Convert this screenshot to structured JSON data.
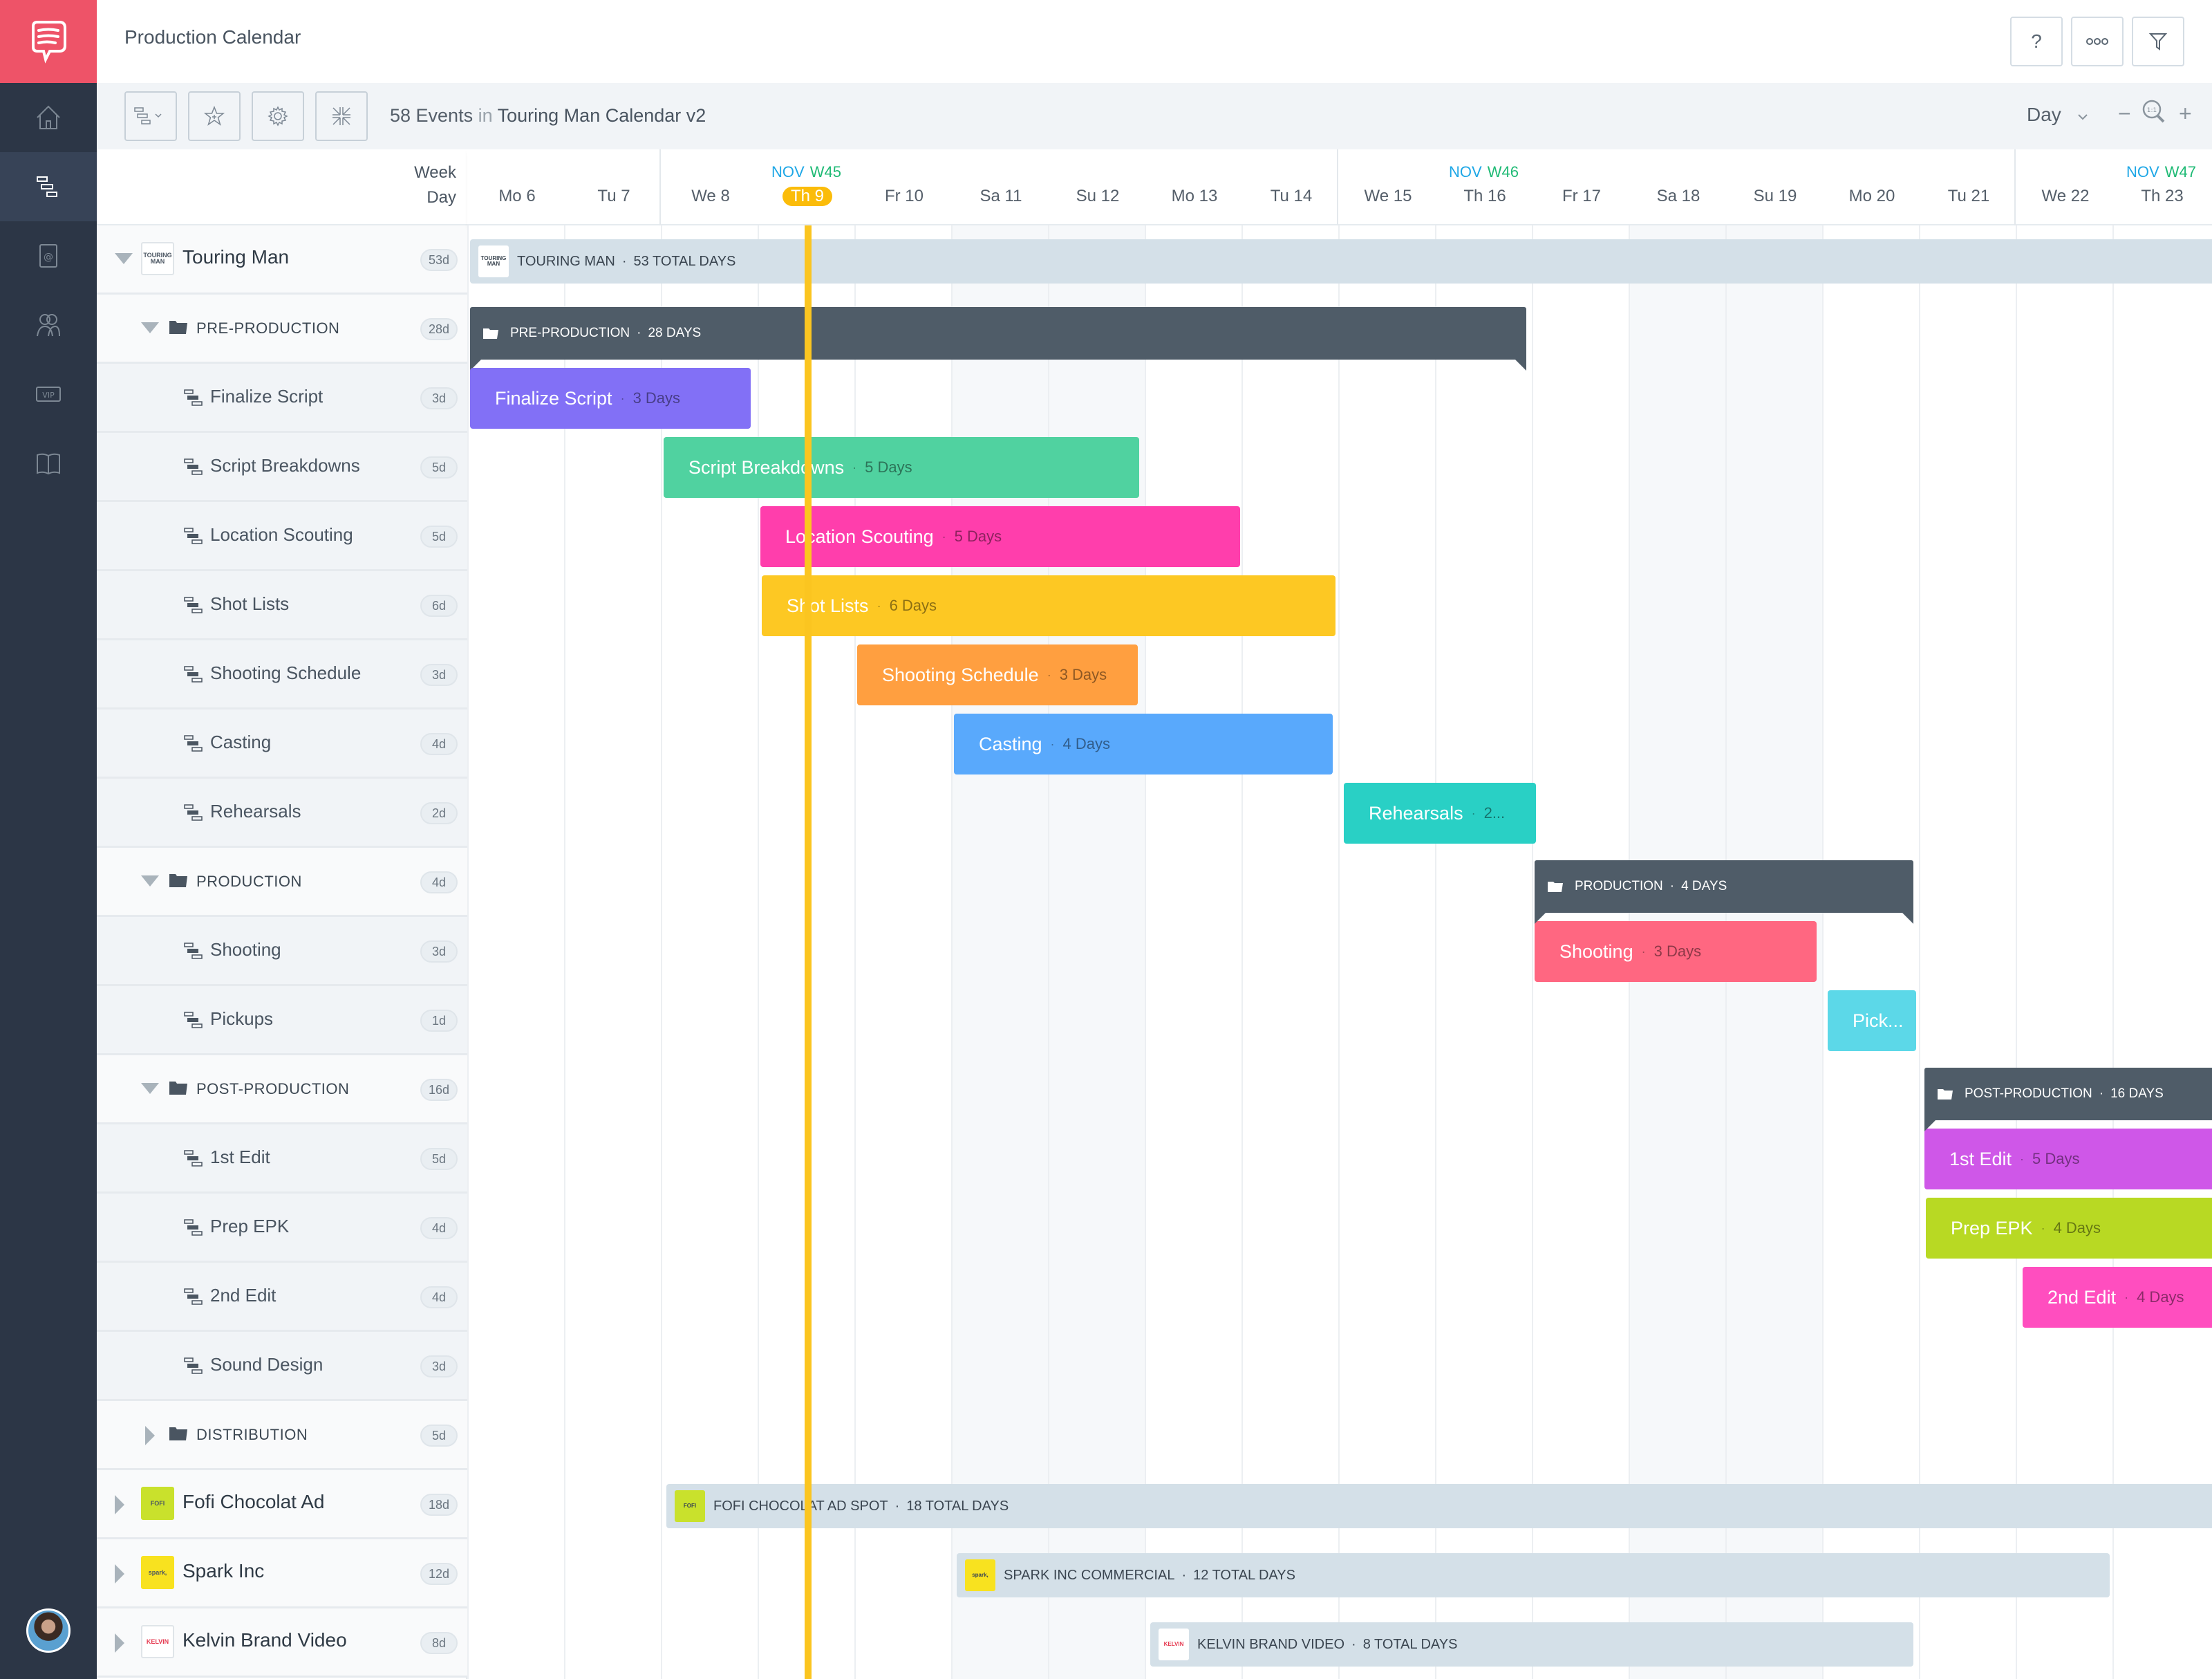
{
  "app": {
    "title": "Production Calendar",
    "events_count": "58 Events",
    "events_in": "in",
    "calendar_name": "Touring Man Calendar v2"
  },
  "topbar": {
    "help_label": "?",
    "more_label": "ooo",
    "filter_label": "filter"
  },
  "toolbar": {
    "view_select": "Day",
    "zoom_out": "−",
    "zoom_reset": "1:1",
    "zoom_in": "+"
  },
  "sidebar": {
    "items": [
      {
        "name": "home"
      },
      {
        "name": "gantt-timeline",
        "active": true
      },
      {
        "name": "contacts"
      },
      {
        "name": "team"
      },
      {
        "name": "vip"
      },
      {
        "name": "script-library"
      }
    ]
  },
  "timeline": {
    "header_week": "Week",
    "header_day": "Day",
    "weeks": [
      {
        "month": "NOV",
        "week": "W45"
      },
      {
        "month": "NOV",
        "week": "W46"
      },
      {
        "month": "NOV",
        "week": "W47"
      }
    ],
    "days": [
      {
        "label": "Mo 6"
      },
      {
        "label": "Tu 7"
      },
      {
        "label": "We 8"
      },
      {
        "label": "Th 9",
        "today": true
      },
      {
        "label": "Fr 10"
      },
      {
        "label": "Sa 11"
      },
      {
        "label": "Su 12"
      },
      {
        "label": "Mo 13"
      },
      {
        "label": "Tu 14"
      },
      {
        "label": "We 15"
      },
      {
        "label": "Th 16"
      },
      {
        "label": "Fr 17"
      },
      {
        "label": "Sa 18"
      },
      {
        "label": "Su 19"
      },
      {
        "label": "Mo 20"
      },
      {
        "label": "Tu 21"
      },
      {
        "label": "We 22"
      },
      {
        "label": "Th 23"
      }
    ]
  },
  "rows": [
    {
      "type": "project",
      "label": "Touring Man",
      "badge": "53d",
      "logo": "TOURING MAN",
      "expanded": true
    },
    {
      "type": "group",
      "label": "PRE-PRODUCTION",
      "badge": "28d",
      "expanded": true
    },
    {
      "type": "task",
      "label": "Finalize Script",
      "badge": "3d"
    },
    {
      "type": "task",
      "label": "Script Breakdowns",
      "badge": "5d"
    },
    {
      "type": "task",
      "label": "Location Scouting",
      "badge": "5d"
    },
    {
      "type": "task",
      "label": "Shot Lists",
      "badge": "6d"
    },
    {
      "type": "task",
      "label": "Shooting Schedule",
      "badge": "3d"
    },
    {
      "type": "task",
      "label": "Casting",
      "badge": "4d"
    },
    {
      "type": "task",
      "label": "Rehearsals",
      "badge": "2d"
    },
    {
      "type": "group",
      "label": "PRODUCTION",
      "badge": "4d",
      "expanded": true
    },
    {
      "type": "task",
      "label": "Shooting",
      "badge": "3d"
    },
    {
      "type": "task",
      "label": "Pickups",
      "badge": "1d"
    },
    {
      "type": "group",
      "label": "POST-PRODUCTION",
      "badge": "16d",
      "expanded": true
    },
    {
      "type": "task",
      "label": "1st Edit",
      "badge": "5d"
    },
    {
      "type": "task",
      "label": "Prep EPK",
      "badge": "4d"
    },
    {
      "type": "task",
      "label": "2nd Edit",
      "badge": "4d"
    },
    {
      "type": "task",
      "label": "Sound Design",
      "badge": "3d"
    },
    {
      "type": "group",
      "label": "DISTRIBUTION",
      "badge": "5d",
      "expanded": false
    },
    {
      "type": "project",
      "label": "Fofi Chocolat Ad",
      "badge": "18d",
      "logo": "FOFI",
      "expanded": false
    },
    {
      "type": "project",
      "label": "Spark Inc",
      "badge": "12d",
      "logo": "spark,",
      "expanded": false
    },
    {
      "type": "project",
      "label": "Kelvin Brand Video",
      "badge": "8d",
      "logo": "KELVIN",
      "expanded": false
    }
  ],
  "bars": {
    "touring_man": {
      "label": "TOURING MAN",
      "sep": "·",
      "duration": "53 TOTAL DAYS"
    },
    "pre_production": {
      "label": "PRE-PRODUCTION",
      "sep": "·",
      "duration": "28 DAYS"
    },
    "finalize_script": {
      "label": "Finalize Script",
      "sep": "·",
      "duration": "3 Days",
      "color": "#8270f6"
    },
    "script_breakdowns": {
      "label": "Script Breakdowns",
      "sep": "·",
      "duration": "5 Days",
      "color": "#50d2a0"
    },
    "location_scouting": {
      "label": "Location Scouting",
      "sep": "·",
      "duration": "5 Days",
      "color": "#ff3eac"
    },
    "shot_lists": {
      "label": "Shot Lists",
      "sep": "·",
      "duration": "6 Days",
      "color": "#fdc823"
    },
    "shooting_schedule": {
      "label": "Shooting Schedule",
      "sep": "·",
      "duration": "3 Days",
      "color": "#ff9f40"
    },
    "casting": {
      "label": "Casting",
      "sep": "·",
      "duration": "4 Days",
      "color": "#59a9fc"
    },
    "rehearsals": {
      "label": "Rehearsals",
      "sep": "·",
      "duration": "2...",
      "color": "#29d0c5"
    },
    "production": {
      "label": "PRODUCTION",
      "sep": "·",
      "duration": "4 DAYS"
    },
    "shooting": {
      "label": "Shooting",
      "sep": "·",
      "duration": "3 Days",
      "color": "#ff6781"
    },
    "pickups": {
      "label": "Pick...",
      "color": "#5cd8e8"
    },
    "post_production": {
      "label": "POST-PRODUCTION",
      "sep": "·",
      "duration": "16 DAYS"
    },
    "first_edit": {
      "label": "1st Edit",
      "sep": "·",
      "duration": "5 Days",
      "color": "#cf57e8"
    },
    "prep_epk": {
      "label": "Prep EPK",
      "sep": "·",
      "duration": "4 Days",
      "color": "#b8d923"
    },
    "second_edit": {
      "label": "2nd Edit",
      "sep": "·",
      "duration": "4 Days",
      "color": "#ff4ebf"
    },
    "fofi": {
      "label": "FOFI CHOCOLAT AD SPOT",
      "sep": "·",
      "duration": "18 TOTAL DAYS",
      "logo": "FOFI"
    },
    "spark": {
      "label": "SPARK INC COMMERCIAL",
      "sep": "·",
      "duration": "12 TOTAL DAYS",
      "logo": "spark,"
    },
    "kelvin": {
      "label": "KELVIN BRAND VIDEO",
      "sep": "·",
      "duration": "8 TOTAL DAYS",
      "logo": "KELVIN"
    }
  },
  "colors": {
    "brand": "#ee5368",
    "sidebar": "#2c3646",
    "today": "#fbbc0a",
    "group_bar": "#4f5c68",
    "project_bar": "#d4e0e8"
  }
}
